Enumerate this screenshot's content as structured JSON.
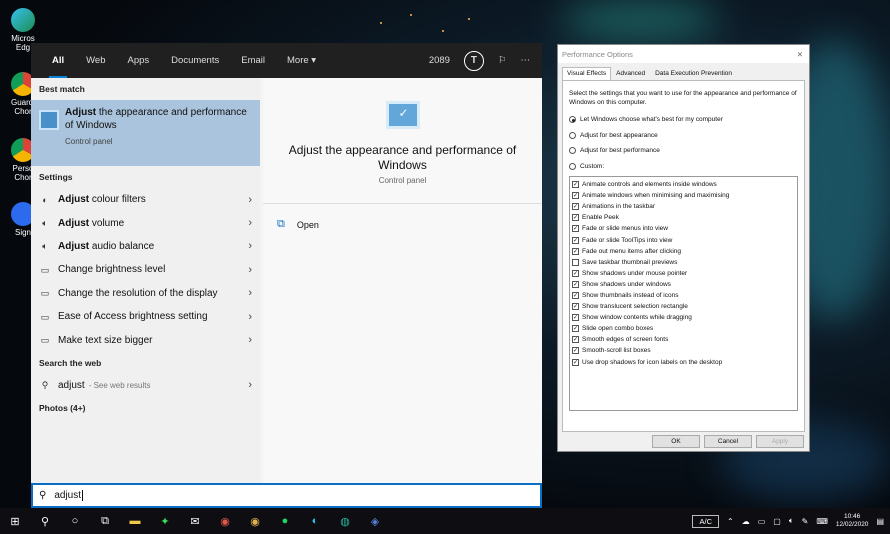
{
  "desktop": {
    "icons": [
      {
        "label": "Micros\nEdg"
      },
      {
        "label": "Guardi\nChor"
      },
      {
        "label": "Perso\nChor"
      },
      {
        "label": "Sign"
      }
    ]
  },
  "search_panel": {
    "tabs": [
      "All",
      "Web",
      "Apps",
      "Documents",
      "Email",
      "More ▾"
    ],
    "points": "2089",
    "badge_letter": "T",
    "best_match_heading": "Best match",
    "best_match": {
      "bold": "Adjust",
      "title_rest": " the appearance and performance of Windows",
      "subtitle": "Control panel"
    },
    "settings_heading": "Settings",
    "settings_items": [
      {
        "bold": "Adjust",
        "rest": " colour filters",
        "icon": "color-filter-icon"
      },
      {
        "bold": "Adjust",
        "rest": " volume",
        "icon": "volume-icon"
      },
      {
        "bold": "Adjust",
        "rest": " audio balance",
        "icon": "audio-icon"
      },
      {
        "bold": "",
        "rest": "Change brightness level",
        "icon": "display-icon"
      },
      {
        "bold": "",
        "rest": "Change the resolution of the display",
        "icon": "display-icon"
      },
      {
        "bold": "",
        "rest": "Ease of Access brightness setting",
        "icon": "display-icon"
      },
      {
        "bold": "",
        "rest": "Make text size bigger",
        "icon": "display-icon"
      }
    ],
    "web_heading": "Search the web",
    "web_item": {
      "query": "adjust",
      "hint": "- See web results"
    },
    "photos_heading": "Photos (4+)",
    "preview": {
      "title": "Adjust the appearance and performance of Windows",
      "subtitle": "Control panel",
      "open_label": "Open"
    },
    "search_value": "adjust"
  },
  "performance_dialog": {
    "title": "Performance Options",
    "tabs": [
      "Visual Effects",
      "Advanced",
      "Data Execution Prevention"
    ],
    "description": "Select the settings that you want to use for the appearance and performance of Windows on this computer.",
    "radios": [
      {
        "label": "Let Windows choose what's best for my computer",
        "selected": true
      },
      {
        "label": "Adjust for best appearance",
        "selected": false
      },
      {
        "label": "Adjust for best performance",
        "selected": false
      },
      {
        "label": "Custom:",
        "selected": false
      }
    ],
    "options": [
      {
        "label": "Animate controls and elements inside windows",
        "checked": true
      },
      {
        "label": "Animate windows when minimising and maximising",
        "checked": true
      },
      {
        "label": "Animations in the taskbar",
        "checked": true
      },
      {
        "label": "Enable Peek",
        "checked": true
      },
      {
        "label": "Fade or slide menus into view",
        "checked": true
      },
      {
        "label": "Fade or slide ToolTips into view",
        "checked": true
      },
      {
        "label": "Fade out menu items after clicking",
        "checked": true
      },
      {
        "label": "Save taskbar thumbnail previews",
        "checked": false
      },
      {
        "label": "Show shadows under mouse pointer",
        "checked": true
      },
      {
        "label": "Show shadows under windows",
        "checked": true
      },
      {
        "label": "Show thumbnails instead of icons",
        "checked": true
      },
      {
        "label": "Show translucent selection rectangle",
        "checked": true
      },
      {
        "label": "Show window contents while dragging",
        "checked": true
      },
      {
        "label": "Slide open combo boxes",
        "checked": true
      },
      {
        "label": "Smooth edges of screen fonts",
        "checked": true
      },
      {
        "label": "Smooth-scroll list boxes",
        "checked": true
      },
      {
        "label": "Use drop shadows for icon labels on the desktop",
        "checked": true
      }
    ],
    "buttons": {
      "ok": "OK",
      "cancel": "Cancel",
      "apply": "Apply"
    }
  },
  "taskbar": {
    "ac_label": "A/C",
    "time": "10:46",
    "date": "12/02/2020"
  }
}
